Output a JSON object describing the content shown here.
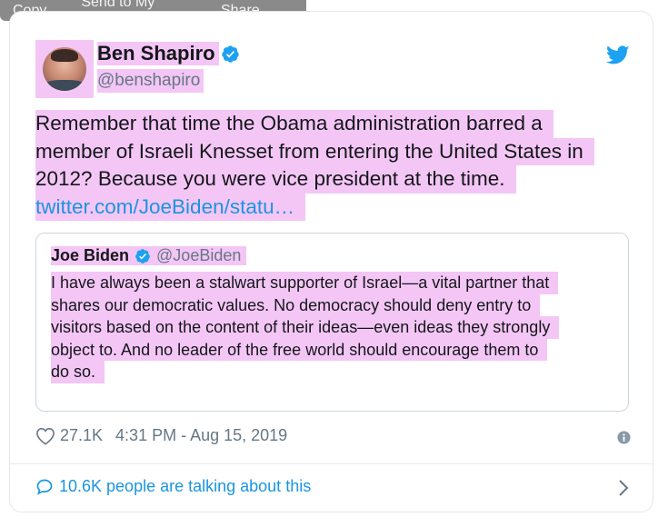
{
  "context_menu": {
    "items": [
      "Copy",
      "Send to My Flow",
      "Share..."
    ]
  },
  "tweet": {
    "display_name": "Ben Shapiro",
    "handle": "@benshapiro",
    "text_lines": [
      "Remember that time the Obama administration barred a",
      "member of Israeli Knesset from entering the United States in",
      "2012? Because you were vice president at the time."
    ],
    "link": "twitter.com/JoeBiden/statu…",
    "likes": "27.1K",
    "timestamp": "4:31 PM - Aug 15, 2019",
    "talking": "10.6K people are talking about this"
  },
  "quoted_tweet": {
    "display_name": "Joe Biden",
    "handle": "@JoeBiden",
    "text_lines": [
      "I have always been a stalwart supporter of Israel—a vital partner that",
      "shares our democratic values. No democracy should deny entry to",
      "visitors based on the content of their ideas—even ideas they strongly",
      "object to. And no leader of the free world should encourage them to",
      "do so."
    ]
  },
  "icons": {
    "verified": "verified-badge-icon",
    "bird": "twitter-bird-icon",
    "heart": "heart-icon",
    "info": "info-icon",
    "bubble": "speech-bubble-icon",
    "chevron": "chevron-right-icon"
  },
  "colors": {
    "highlight": "#f4c6f6",
    "link": "#1b95e0",
    "verified": "#1da1f2",
    "muted": "#657786"
  }
}
